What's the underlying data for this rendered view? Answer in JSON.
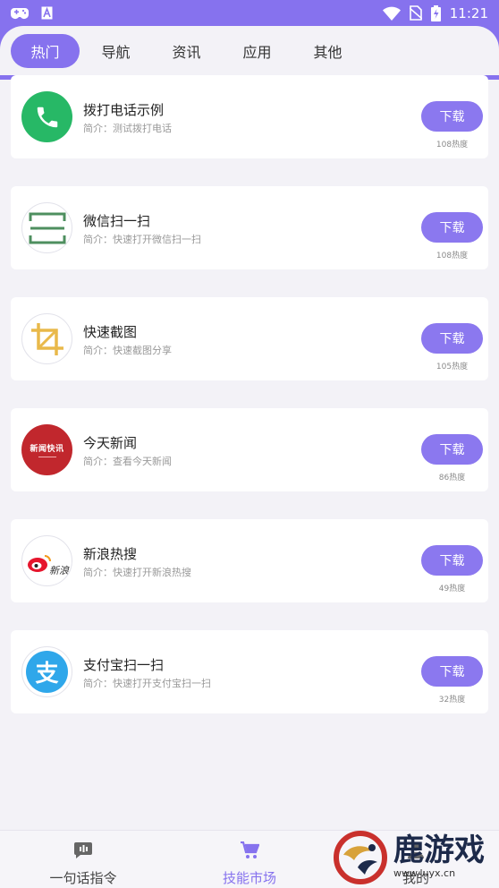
{
  "status_bar": {
    "time": "11:21",
    "icons": [
      "gamepad-icon",
      "a-box-icon",
      "wifi-icon",
      "no-sim-icon",
      "battery-charging-icon"
    ]
  },
  "tabs": [
    {
      "label": "热门",
      "active": true
    },
    {
      "label": "导航",
      "active": false
    },
    {
      "label": "资讯",
      "active": false
    },
    {
      "label": "应用",
      "active": false
    },
    {
      "label": "其他",
      "active": false
    }
  ],
  "apps": [
    {
      "name": "拨打电话示例",
      "desc": "简介：测试拨打电话",
      "button": "下载",
      "heat": "108热度",
      "icon": "phone-icon"
    },
    {
      "name": "微信扫一扫",
      "desc": "简介：快速打开微信扫一扫",
      "button": "下载",
      "heat": "108热度",
      "icon": "scan-icon"
    },
    {
      "name": "快速截图",
      "desc": "简介：快速截图分享",
      "button": "下载",
      "heat": "105热度",
      "icon": "crop-icon"
    },
    {
      "name": "今天新闻",
      "desc": "简介：查看今天新闻",
      "button": "下载",
      "heat": "86热度",
      "icon": "news-logo-icon",
      "icon_text": "新闻快讯"
    },
    {
      "name": "新浪热搜",
      "desc": "简介：快速打开新浪热搜",
      "button": "下载",
      "heat": "49热度",
      "icon": "weibo-logo-icon",
      "icon_text": "新浪"
    },
    {
      "name": "支付宝扫一扫",
      "desc": "简介：快速打开支付宝扫一扫",
      "button": "下载",
      "heat": "32热度",
      "icon": "alipay-logo-icon",
      "icon_text": "支"
    }
  ],
  "bottom_nav": [
    {
      "label": "一句话指令",
      "icon": "chat-voice-icon",
      "active": false
    },
    {
      "label": "技能市场",
      "icon": "cart-icon",
      "active": true
    },
    {
      "label": "我的",
      "icon": "user-icon",
      "active": false
    }
  ],
  "watermark": {
    "text": "鹿游戏",
    "url": "www.luyx.cn"
  },
  "colors": {
    "accent": "#8672ee",
    "button": "#8b78ef",
    "background": "#f3f2f7"
  }
}
